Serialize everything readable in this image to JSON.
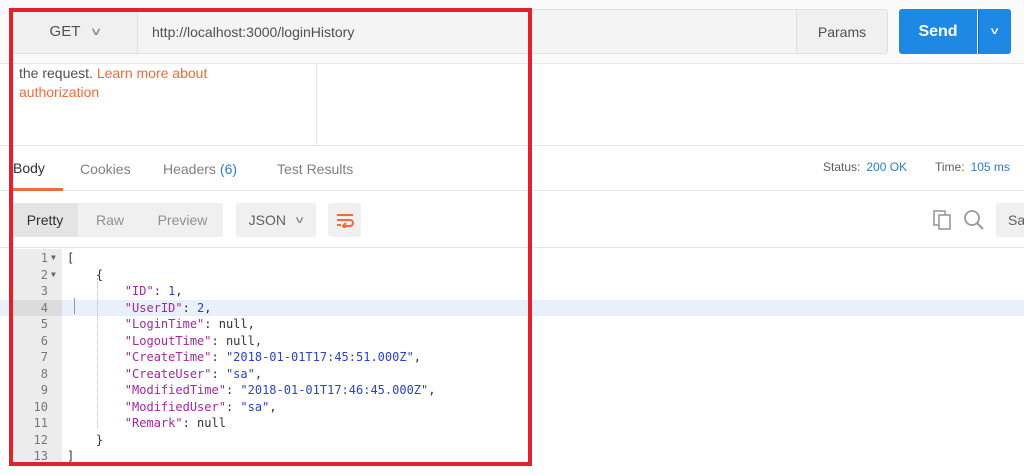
{
  "request": {
    "method": "GET",
    "url": "http://localhost:3000/loginHistory",
    "params_label": "Params",
    "send_label": "Send"
  },
  "auth_note": {
    "text": "the request. ",
    "link_line1": "Learn more about",
    "link_line2": "authorization"
  },
  "response_tabs": [
    {
      "label": "Body",
      "active": true
    },
    {
      "label": "Cookies"
    },
    {
      "label": "Headers",
      "count": "(6)"
    },
    {
      "label": "Test Results"
    }
  ],
  "status": {
    "status_label": "Status:",
    "status_value": "200 OK",
    "time_label": "Time:",
    "time_value": "105 ms"
  },
  "toolbar": {
    "views": [
      "Pretty",
      "Raw",
      "Preview"
    ],
    "format": "JSON",
    "save_label": "Sav"
  },
  "editor": {
    "lines": [
      {
        "n": "1",
        "fold": "▼",
        "tokens": [
          [
            "p",
            "["
          ]
        ]
      },
      {
        "n": "2",
        "fold": "▼",
        "tokens": [
          [
            "p",
            "    {"
          ]
        ]
      },
      {
        "n": "3",
        "tokens": [
          [
            "p",
            "        "
          ],
          [
            "k",
            "\"ID\""
          ],
          [
            "p",
            ": "
          ],
          [
            "n",
            "1"
          ],
          [
            "p",
            ","
          ]
        ]
      },
      {
        "n": "4",
        "tokens": [
          [
            "p",
            "        "
          ],
          [
            "k",
            "\"UserID\""
          ],
          [
            "p",
            ": "
          ],
          [
            "n",
            "2"
          ],
          [
            "p",
            ","
          ]
        ],
        "highlight": true
      },
      {
        "n": "5",
        "tokens": [
          [
            "p",
            "        "
          ],
          [
            "k",
            "\"LoginTime\""
          ],
          [
            "p",
            ": null,"
          ]
        ]
      },
      {
        "n": "6",
        "tokens": [
          [
            "p",
            "        "
          ],
          [
            "k",
            "\"LogoutTime\""
          ],
          [
            "p",
            ": null,"
          ]
        ]
      },
      {
        "n": "7",
        "tokens": [
          [
            "p",
            "        "
          ],
          [
            "k",
            "\"CreateTime\""
          ],
          [
            "p",
            ": "
          ],
          [
            "s",
            "\"2018-01-01T17:45:51.000Z\""
          ],
          [
            "p",
            ","
          ]
        ]
      },
      {
        "n": "8",
        "tokens": [
          [
            "p",
            "        "
          ],
          [
            "k",
            "\"CreateUser\""
          ],
          [
            "p",
            ": "
          ],
          [
            "s",
            "\"sa\""
          ],
          [
            "p",
            ","
          ]
        ]
      },
      {
        "n": "9",
        "tokens": [
          [
            "p",
            "        "
          ],
          [
            "k",
            "\"ModifiedTime\""
          ],
          [
            "p",
            ": "
          ],
          [
            "s",
            "\"2018-01-01T17:46:45.000Z\""
          ],
          [
            "p",
            ","
          ]
        ]
      },
      {
        "n": "10",
        "tokens": [
          [
            "p",
            "        "
          ],
          [
            "k",
            "\"ModifiedUser\""
          ],
          [
            "p",
            ": "
          ],
          [
            "s",
            "\"sa\""
          ],
          [
            "p",
            ","
          ]
        ]
      },
      {
        "n": "11",
        "tokens": [
          [
            "p",
            "        "
          ],
          [
            "k",
            "\"Remark\""
          ],
          [
            "p",
            ": null"
          ]
        ]
      },
      {
        "n": "12",
        "tokens": [
          [
            "p",
            "    }"
          ]
        ]
      },
      {
        "n": "13",
        "tokens": [
          [
            "p",
            "]"
          ]
        ]
      }
    ]
  },
  "colors": {
    "accent": "#f26b3a",
    "send": "#1e88e5",
    "highlight_frame": "#e3202b"
  }
}
